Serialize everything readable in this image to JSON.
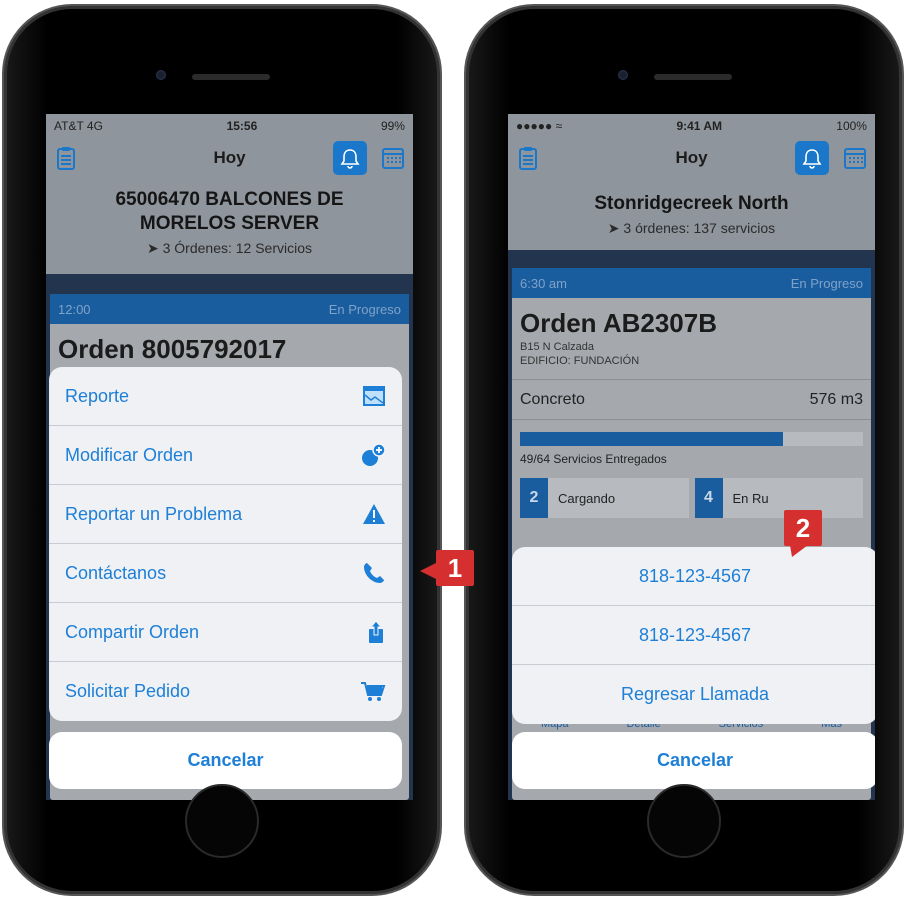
{
  "left": {
    "status": {
      "left": "AT&T 4G",
      "time": "15:56",
      "right": "99%"
    },
    "nav_title": "Hoy",
    "header_title": "65006470 BALCONES DE MORELOS SERVER",
    "header_sub": "3 Órdenes: 12 Servicios",
    "card_time": "12:00",
    "card_status": "En Progreso",
    "card_title": "Orden 8005792017",
    "menu": [
      {
        "label": "Reporte",
        "icon": "report-icon"
      },
      {
        "label": "Modificar Orden",
        "icon": "modify-order-icon"
      },
      {
        "label": "Reportar un Problema",
        "icon": "warning-icon"
      },
      {
        "label": "Contáctanos",
        "icon": "phone-icon"
      },
      {
        "label": "Compartir Orden",
        "icon": "share-icon"
      },
      {
        "label": "Solicitar Pedido",
        "icon": "cart-icon"
      }
    ],
    "cancel": "Cancelar",
    "badge": "1"
  },
  "right": {
    "status": {
      "time": "9:41 AM",
      "right": "100%"
    },
    "nav_title": "Hoy",
    "header_title": "Stonridgecreek North",
    "header_sub": "3 órdenes: 137 servicios",
    "card_time": "6:30 am",
    "card_status": "En Progreso",
    "card_title": "Orden AB2307B",
    "address1": "B15 N Calzada",
    "address2": "EDIFICIO: FUNDACIÓN",
    "product": "Concreto",
    "quantity": "576 m3",
    "progress_fraction": 0.766,
    "progress_label": "49/64 Servicios Entregados",
    "stat1_count": "2",
    "stat1_label": "Cargando",
    "stat2_count": "4",
    "stat2_label": "En Ru",
    "tabs": [
      "Mapa",
      "Detalle",
      "Servicios",
      "Más"
    ],
    "menu": [
      "818-123-4567",
      "818-123-4567",
      "Regresar Llamada"
    ],
    "cancel": "Cancelar",
    "badge": "2"
  },
  "colors": {
    "accent": "#1d7fd6",
    "badge": "#d62f2f",
    "card_bar": "#1a5d9f"
  }
}
